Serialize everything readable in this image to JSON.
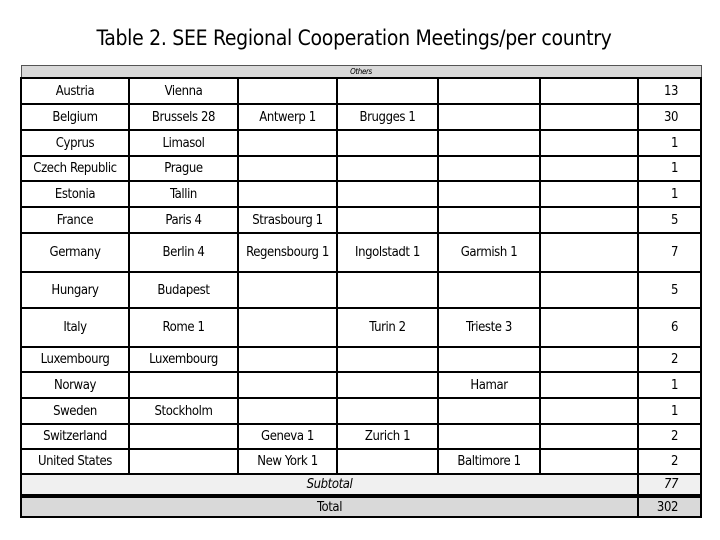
{
  "title": "Table 2. SEE Regional Cooperation Meetings/per country",
  "header": {
    "others": "Others"
  },
  "rows": [
    {
      "country": "Austria",
      "c1": "Vienna",
      "c2": "",
      "c3": "",
      "c4": "",
      "c5": "",
      "total": "13",
      "h": 26
    },
    {
      "country": "Belgium",
      "c1": "Brussels 28",
      "c2": "Antwerp 1",
      "c3": "Brugges 1",
      "c4": "",
      "c5": "",
      "total": "30",
      "h": 26
    },
    {
      "country": "Cyprus",
      "c1": "Limasol",
      "c2": "",
      "c3": "",
      "c4": "",
      "c5": "",
      "total": "1",
      "h": 26
    },
    {
      "country": "Czech Republic",
      "c1": "Prague",
      "c2": "",
      "c3": "",
      "c4": "",
      "c5": "",
      "total": "1",
      "h": 25
    },
    {
      "country": "Estonia",
      "c1": "Tallin",
      "c2": "",
      "c3": "",
      "c4": "",
      "c5": "",
      "total": "1",
      "h": 26
    },
    {
      "country": "France",
      "c1": "Paris  4",
      "c2": "Strasbourg 1",
      "c3": "",
      "c4": "",
      "c5": "",
      "total": "5",
      "h": 26
    },
    {
      "country": "Germany",
      "c1": "Berlin 4",
      "c2": "Regensbourg 1",
      "c3": "Ingolstadt 1",
      "c4": "Garmish 1",
      "c5": "",
      "total": "7",
      "h": 39
    },
    {
      "country": "Hungary",
      "c1": "Budapest",
      "c2": "",
      "c3": "",
      "c4": "",
      "c5": "",
      "total": "5",
      "h": 36
    },
    {
      "country": "Italy",
      "c1": "Rome 1",
      "c2": "",
      "c3": "Turin 2",
      "c4": "Trieste 3",
      "c5": "",
      "total": "6",
      "h": 39
    },
    {
      "country": "Luxembourg",
      "c1": "Luxembourg",
      "c2": "",
      "c3": "",
      "c4": "",
      "c5": "",
      "total": "2",
      "h": 25
    },
    {
      "country": "Norway",
      "c1": "",
      "c2": "",
      "c3": "",
      "c4": "Hamar",
      "c5": "",
      "total": "1",
      "h": 26
    },
    {
      "country": "Sweden",
      "c1": "Stockholm",
      "c2": "",
      "c3": "",
      "c4": "",
      "c5": "",
      "total": "1",
      "h": 26
    },
    {
      "country": "Switzerland",
      "c1": "",
      "c2": "Geneva  1",
      "c3": "Zurich  1",
      "c4": "",
      "c5": "",
      "total": "2",
      "h": 25
    },
    {
      "country": "United States",
      "c1": "",
      "c2": "New York 1",
      "c3": "",
      "c4": "Baltimore 1",
      "c5": "",
      "total": "2",
      "h": 25
    }
  ],
  "subtotal": {
    "label": "Subtotal",
    "value": "77"
  },
  "total": {
    "label": "Total",
    "value": "302"
  }
}
